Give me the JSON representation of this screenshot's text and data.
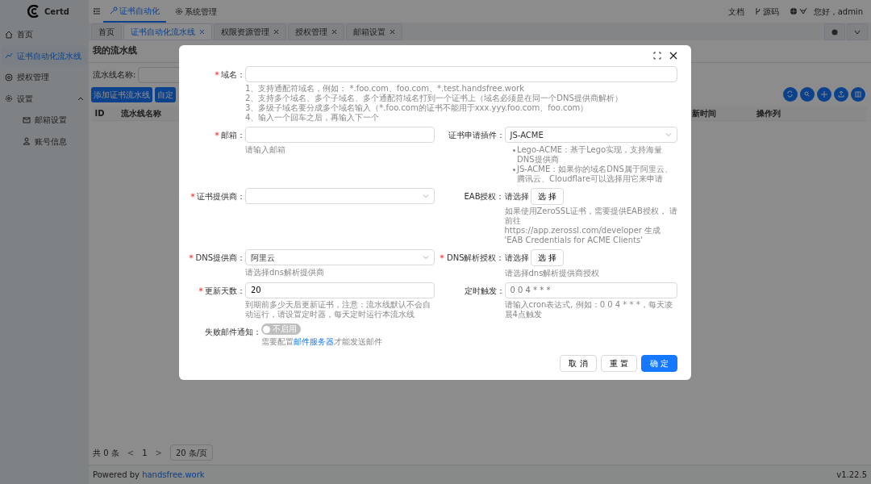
{
  "header": {
    "brand": "Certd",
    "nav": [
      {
        "label": "证书自动化",
        "selected": true
      },
      {
        "label": "系统管理",
        "selected": false
      }
    ],
    "links": [
      "文档",
      "源码"
    ],
    "greeting": "您好，admin"
  },
  "sidebar": {
    "items": [
      {
        "label": "首页",
        "selected": false
      },
      {
        "label": "证书自动化流水线",
        "selected": true
      },
      {
        "label": "授权管理",
        "selected": false
      },
      {
        "label": "设置",
        "selected": false,
        "expanded": true,
        "children": [
          {
            "label": "邮箱设置",
            "selected": false
          },
          {
            "label": "账号信息",
            "selected": false
          }
        ]
      }
    ]
  },
  "tabs": [
    {
      "label": "首页",
      "selected": false,
      "closable": false
    },
    {
      "label": "证书自动化流水线",
      "selected": true,
      "closable": true
    },
    {
      "label": "权限资源管理",
      "selected": false,
      "closable": true
    },
    {
      "label": "授权管理",
      "selected": false,
      "closable": true
    },
    {
      "label": "邮箱设置",
      "selected": false,
      "closable": true
    }
  ],
  "page": {
    "title": "我的流水线",
    "search_label": "流水线名称:",
    "buttons": [
      "添加证书流水线",
      "自定"
    ],
    "columns": [
      "ID",
      "流水线名称",
      "新时间",
      "操作列"
    ]
  },
  "pagination": {
    "total": "共 0 条",
    "prev": "<",
    "page": "1",
    "next": ">",
    "page_size": "20 条/页"
  },
  "footer": {
    "powered": "Powered by",
    "link": "handsfree.work",
    "version": "v1.22.5"
  },
  "modal": {
    "rows": [
      {
        "fields": [
          {
            "label": "域名：",
            "required": true,
            "kind": "input",
            "wide": true,
            "help_lines": [
              "1、支持通配符域名，例如： *.foo.com、foo.com、*.test.handsfree.work",
              "2、支持多个域名、多个子域名、多个通配符域名打到一个证书上（域名必须是在同一个DNS提供商解析）",
              "3、多级子域名要分成多个域名输入（*.foo.com的证书不能用于xxx.yyy.foo.com、foo.com）",
              "4、输入一个回车之后，再输入下一个"
            ]
          }
        ]
      },
      {
        "fields": [
          {
            "label": "邮箱：",
            "required": true,
            "kind": "input",
            "help_lines": [
              "请输入邮箱"
            ]
          },
          {
            "label": "证书申请插件：",
            "required": false,
            "kind": "select",
            "value": "JS-ACME",
            "help_bullets": [
              "Lego-ACME：基于Lego实现，支持海量DNS提供商",
              "JS-ACME：如果你的域名DNS属于阿里云、腾讯云、Cloudflare可以选择用它来申请"
            ]
          }
        ]
      },
      {
        "fields": [
          {
            "label": "证书提供商：",
            "required": true,
            "kind": "select"
          },
          {
            "label": "EAB授权：",
            "required": false,
            "kind": "picker",
            "value": "请选择",
            "button": "选 择",
            "help_lines": [
              "如果使用ZeroSSL证书，需要提供EAB授权， 请前往",
              "https://app.zerossl.com/developer 生成 'EAB Credentials for ACME Clients'"
            ]
          }
        ]
      },
      {
        "fields": [
          {
            "label": "DNS提供商：",
            "required": true,
            "kind": "select",
            "value": "阿里云",
            "help_lines": [
              "请选择dns解析提供商"
            ]
          },
          {
            "label": "DNS解析授权：",
            "required": true,
            "kind": "picker",
            "value": "请选择",
            "button": "选 择",
            "help_lines": [
              "请选择dns解析提供商授权"
            ]
          }
        ]
      },
      {
        "fields": [
          {
            "label": "更新天数：",
            "required": true,
            "kind": "input",
            "value": "20",
            "help_lines": [
              "到期前多少天后更新证书，注意：流水线默认不会自动运行，请设置定时器，每天定时运行本流水线"
            ]
          },
          {
            "label": "定时触发：",
            "required": false,
            "kind": "input",
            "placeholder": "0 0 4 * * *",
            "help_lines": [
              "请输入cron表达式, 例如：0 0 4 * * *，每天凌晨4点触发"
            ]
          }
        ]
      },
      {
        "fields": [
          {
            "label": "失败邮件通知：",
            "required": false,
            "kind": "switch",
            "on": false,
            "switch_label": "不启用",
            "help_parts": [
              {
                "text": "需要配置",
                "link": false
              },
              {
                "text": "邮件服务器",
                "link": true
              },
              {
                "text": "才能发送邮件",
                "link": false
              }
            ]
          }
        ]
      }
    ],
    "buttons": [
      {
        "label": "取 消",
        "kind": "default"
      },
      {
        "label": "重 置",
        "kind": "default"
      },
      {
        "label": "确 定",
        "kind": "primary"
      }
    ]
  }
}
